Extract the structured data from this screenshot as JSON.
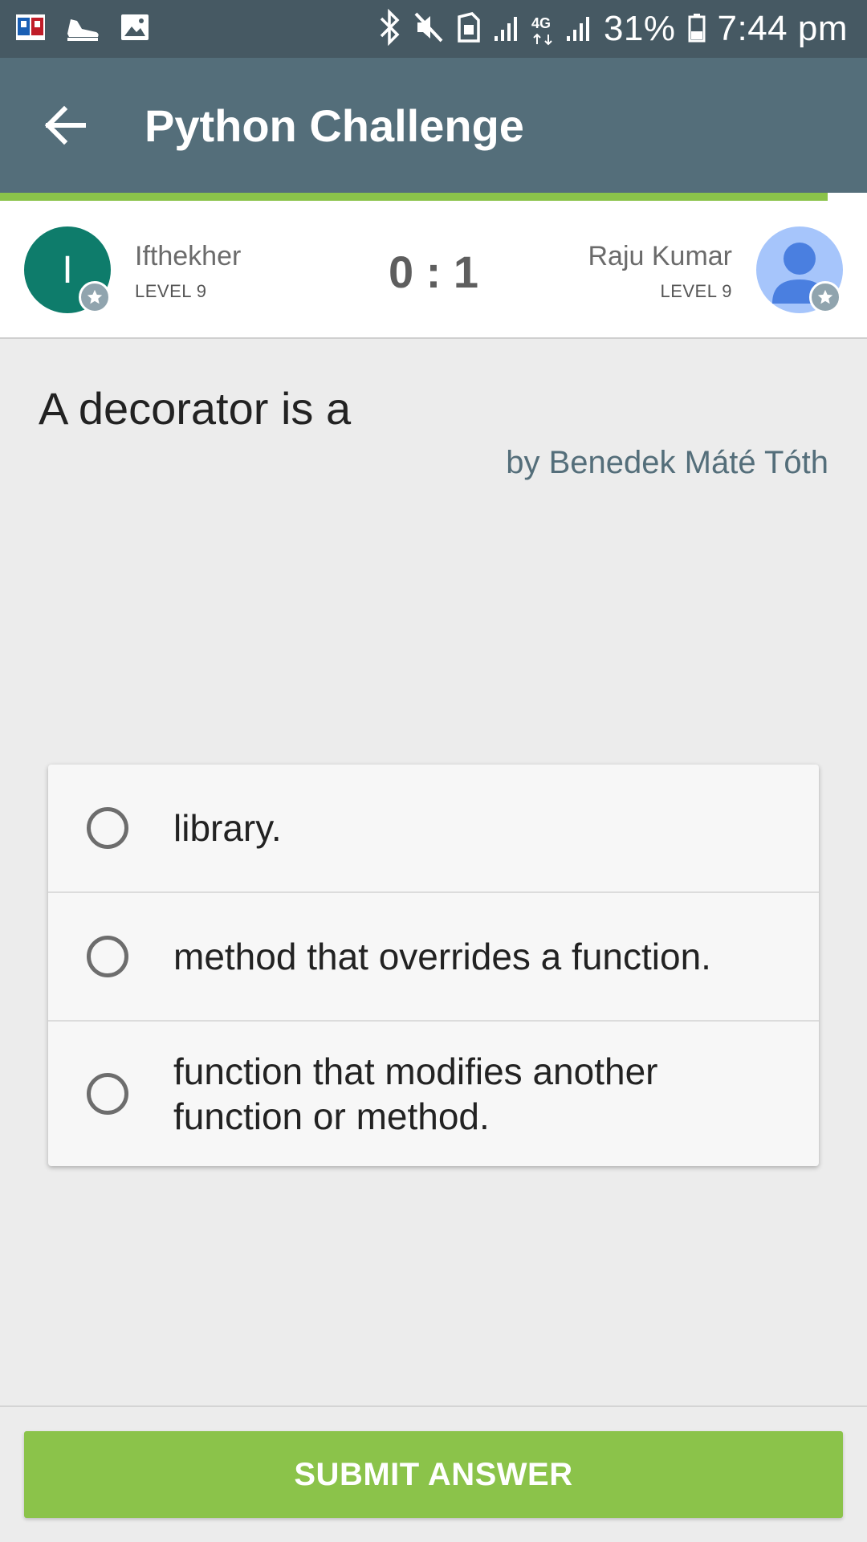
{
  "status_bar": {
    "battery": "31%",
    "time": "7:44 pm",
    "network": "4G",
    "icons": [
      "dictionary-app-icon",
      "shoe-icon",
      "image-icon",
      "bluetooth-icon",
      "mute-icon",
      "sim-icon",
      "signal-icon",
      "battery-icon"
    ]
  },
  "app_bar": {
    "title": "Python Challenge",
    "back_icon": "arrow-left-icon"
  },
  "progress": {
    "fraction": 0.955,
    "color": "#8bc34a"
  },
  "players": {
    "left": {
      "initial": "I",
      "name": "Ifthekher",
      "level": "LEVEL 9",
      "avatar_color": "#0e7c6b"
    },
    "right": {
      "name": "Raju Kumar",
      "level": "LEVEL 9",
      "avatar_color": "#a6c5fb",
      "avatar_icon": "person-icon"
    },
    "score": "0 : 1"
  },
  "question": {
    "text": "A decorator is a",
    "author": "by Benedek Máté Tóth"
  },
  "answers": [
    {
      "text": "library."
    },
    {
      "text": "method that overrides a function."
    },
    {
      "text": "function that modifies another function or method."
    }
  ],
  "submit_label": "SUBMIT ANSWER",
  "colors": {
    "status_bar": "#465963",
    "app_bar": "#546e7a",
    "accent": "#8bc34a"
  }
}
